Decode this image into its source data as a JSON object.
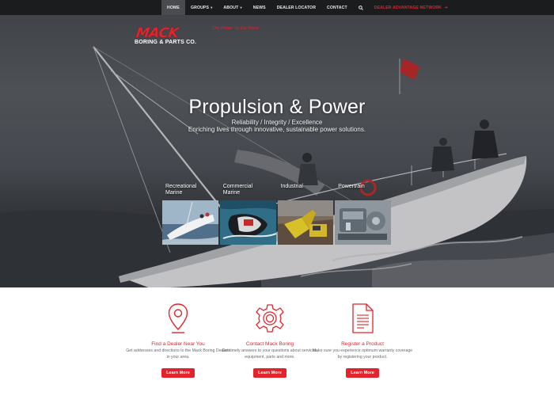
{
  "nav": {
    "items": [
      {
        "label": "HOME",
        "active": true,
        "caret": false
      },
      {
        "label": "GROUPS",
        "active": false,
        "caret": true
      },
      {
        "label": "ABOUT",
        "active": false,
        "caret": true
      },
      {
        "label": "NEWS",
        "active": false,
        "caret": false
      },
      {
        "label": "DEALER LOCATOR",
        "active": false,
        "caret": false
      },
      {
        "label": "CONTACT",
        "active": false,
        "caret": false
      }
    ],
    "search_icon": "search-icon",
    "dealer_link": "DEALER ADVANTAGE NETWORK",
    "dealer_icon": "exit-icon"
  },
  "brand": {
    "logo_main": "MACK",
    "logo_sub": "BORING & PARTS CO.",
    "tagline": "The Power To Go There",
    "accent_color": "#e3232b"
  },
  "hero": {
    "title": "Propulsion & Power",
    "line1": "Reliability / Integrity / Excellence",
    "line2": "Enriching lives through innovative, sustainable power solutions."
  },
  "tiles": [
    {
      "label_line1": "Recreational",
      "label_line2": "Marine"
    },
    {
      "label_line1": "Commercial",
      "label_line2": "Marine"
    },
    {
      "label_line1": "Industrial",
      "label_line2": ""
    },
    {
      "label_line1": "Powertrain",
      "label_line2": ""
    }
  ],
  "features": [
    {
      "icon": "map-pin-icon",
      "title": "Find a Dealer Near You",
      "desc": "Get addresses and directions to the Mack Boring Dealers in your area.",
      "button": "Learn More"
    },
    {
      "icon": "gear-icon",
      "title": "Contact Mack Boring",
      "desc": "Get timely answers to your questions about services, equipment, parts and more.",
      "button": "Learn More"
    },
    {
      "icon": "document-icon",
      "title": "Register a Product",
      "desc": "Make sure you experience optimum warranty coverage by registering your product.",
      "button": "Learn More"
    }
  ]
}
